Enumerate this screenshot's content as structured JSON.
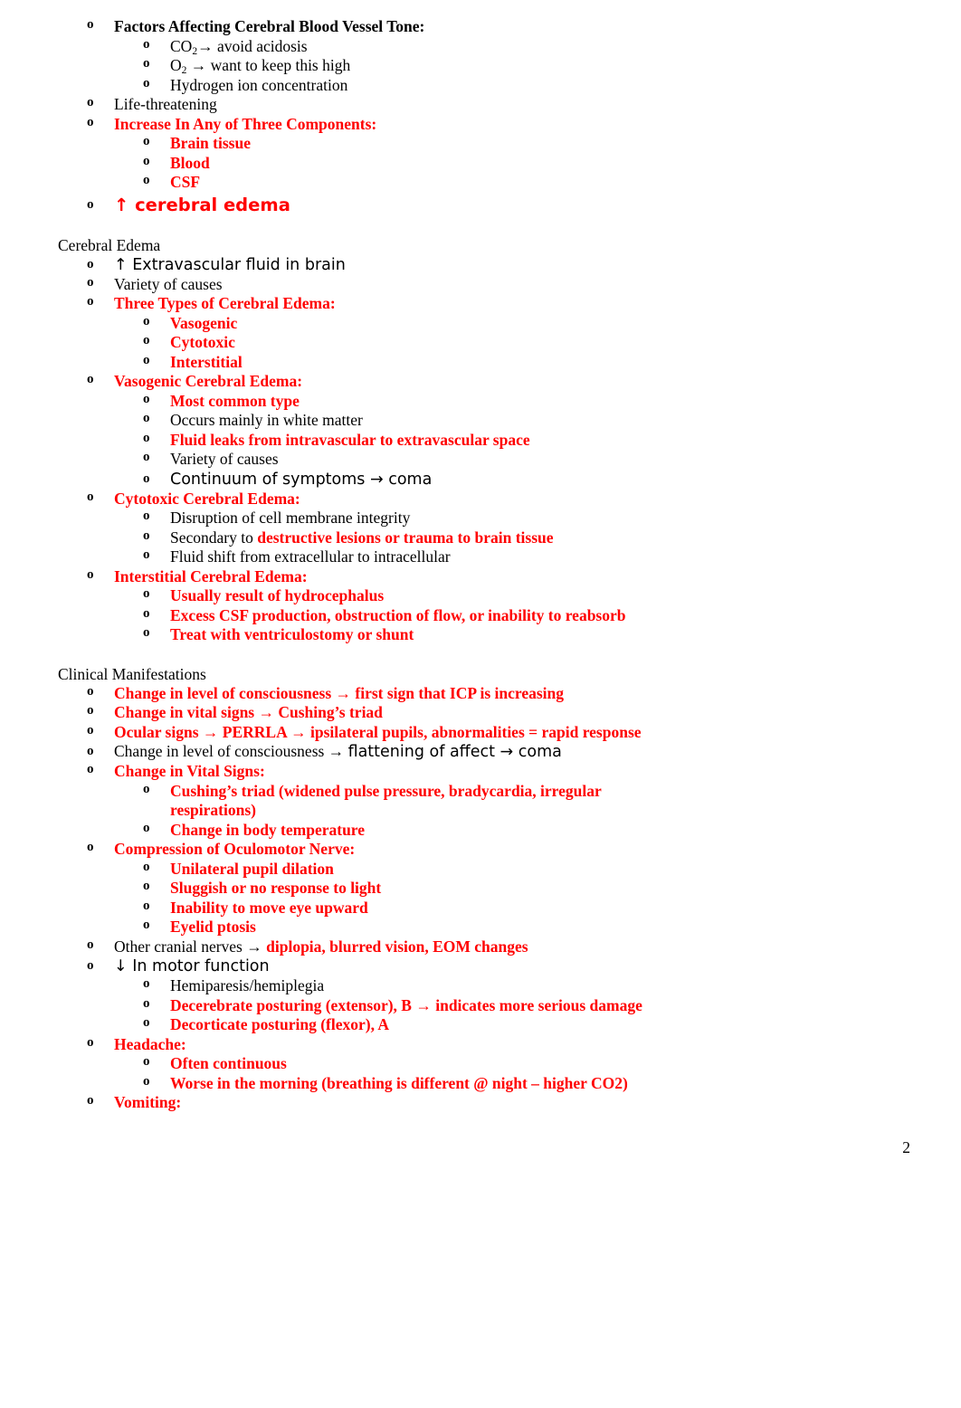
{
  "document": {
    "page_number": "2",
    "accent_color": "#FF0000",
    "text_color": "#000000"
  },
  "sections": [
    {
      "id": "icp-factors",
      "heading": null,
      "lines": [
        {
          "level": 1,
          "bullet": "o",
          "style": "serif-b",
          "color": "red_no",
          "text": "Factors Affecting Cerebral Blood Vessel Tone:"
        },
        {
          "level": 2,
          "bullet": "o",
          "style": "serif",
          "text": "CO2→ avoid acidosis"
        },
        {
          "level": 2,
          "bullet": "o",
          "style": "serif",
          "text": "O2 → want to keep this high"
        },
        {
          "level": 2,
          "bullet": "o",
          "style": "serif",
          "text": "Hydrogen ion concentration"
        },
        {
          "level": 1,
          "bullet": "o",
          "style": "serif",
          "text": "Life-threatening"
        },
        {
          "level": 1,
          "bullet": "o",
          "style": "serif-b",
          "text": "Increase In Any of Three Components:"
        },
        {
          "level": 2,
          "bullet": "o",
          "style": "serif-b",
          "text": "Brain tissue"
        },
        {
          "level": 2,
          "bullet": "o",
          "style": "serif-b",
          "text": "Blood"
        },
        {
          "level": 2,
          "bullet": "o",
          "style": "serif-b",
          "text": "CSF"
        },
        {
          "level": 1,
          "bullet": "o",
          "style": "sans-b",
          "text": "↑ cerebral edema"
        }
      ]
    },
    {
      "id": "cerebral-edema",
      "heading": "Cerebral Edema",
      "lines": [
        {
          "level": 1,
          "bullet": "o",
          "style": "sans",
          "text": "↑ Extravascular fluid in brain"
        },
        {
          "level": 1,
          "bullet": "o",
          "style": "serif",
          "text": "Variety of causes"
        },
        {
          "level": 1,
          "bullet": "o",
          "style": "serif-b",
          "text": "Three Types of Cerebral Edema:"
        },
        {
          "level": 2,
          "bullet": "o",
          "style": "serif-b",
          "text": "Vasogenic"
        },
        {
          "level": 2,
          "bullet": "o",
          "style": "serif-b",
          "text": "Cytotoxic"
        },
        {
          "level": 2,
          "bullet": "o",
          "style": "serif-b",
          "text": "Interstitial"
        },
        {
          "level": 1,
          "bullet": "o",
          "style": "serif-b",
          "text": "Vasogenic Cerebral Edema:"
        },
        {
          "level": 2,
          "bullet": "o",
          "style": "serif-b",
          "text": "Most common type"
        },
        {
          "level": 2,
          "bullet": "o",
          "style": "serif",
          "text": "Occurs mainly in white matter"
        },
        {
          "level": 2,
          "bullet": "o",
          "style": "serif-b",
          "text": "Fluid leaks from intravascular to extravascular space"
        },
        {
          "level": 2,
          "bullet": "o",
          "style": "serif",
          "text": "Variety of causes"
        },
        {
          "level": 2,
          "bullet": "o",
          "style": "sans",
          "text": "Continuum of symptoms → coma"
        },
        {
          "level": 1,
          "bullet": "o",
          "style": "serif-b",
          "text": "Cytotoxic Cerebral Edema:"
        },
        {
          "level": 2,
          "bullet": "o",
          "style": "serif",
          "text": "Disruption of  cell membrane integrity"
        },
        {
          "level": 2,
          "bullet": "o",
          "style": "serif",
          "text": "Secondary to destructive lesions or trauma to brain tissue"
        },
        {
          "level": 2,
          "bullet": "o",
          "style": "serif",
          "text": "Fluid shift from extracellular to intracellular"
        },
        {
          "level": 1,
          "bullet": "o",
          "style": "serif-b",
          "text": "Interstitial Cerebral Edema:"
        },
        {
          "level": 2,
          "bullet": "o",
          "style": "serif-b",
          "text": "Usually result of  hydrocephalus"
        },
        {
          "level": 2,
          "bullet": "o",
          "style": "serif-b",
          "text": "Excess CSF production, obstruction of flow, or inability to reabsorb"
        },
        {
          "level": 2,
          "bullet": "o",
          "style": "serif-b",
          "text": "Treat with ventriculostomy or shunt"
        }
      ]
    },
    {
      "id": "clinical-manifestations",
      "heading": "Clinical Manifestations",
      "lines": [
        {
          "level": 1,
          "bullet": "o",
          "style": "serif-b",
          "text": "Change in level of consciousness → first sign that ICP is increasing"
        },
        {
          "level": 1,
          "bullet": "o",
          "style": "serif-b",
          "text": "Change in vital signs → Cushing’s triad"
        },
        {
          "level": 1,
          "bullet": "o",
          "style": "serif-b",
          "text": "Ocular signs → PERRLA → ipsilateral pupils, abnormalities = rapid response"
        },
        {
          "level": 1,
          "bullet": "o",
          "style": "mixed",
          "text": "Change in level of consciousness → flattening of affect → coma"
        },
        {
          "level": 1,
          "bullet": "o",
          "style": "serif-b",
          "text": "Change in Vital Signs:"
        },
        {
          "level": 2,
          "bullet": "o",
          "style": "serif-b",
          "text": "Cushing’s triad (widened pulse pressure, bradycardia, irregular respirations)"
        },
        {
          "level": 2,
          "bullet": "o",
          "style": "serif-b",
          "text": "Change in body temperature"
        },
        {
          "level": 1,
          "bullet": "o",
          "style": "serif-b",
          "text": "Compression of Oculomotor Nerve:"
        },
        {
          "level": 2,
          "bullet": "o",
          "style": "serif-b",
          "text": "Unilateral pupil dilation"
        },
        {
          "level": 2,
          "bullet": "o",
          "style": "serif-b",
          "text": "Sluggish or no response to light"
        },
        {
          "level": 2,
          "bullet": "o",
          "style": "serif-b",
          "text": "Inability to move eye upward"
        },
        {
          "level": 2,
          "bullet": "o",
          "style": "serif-b",
          "text": "Eyelid ptosis"
        },
        {
          "level": 1,
          "bullet": "o",
          "style": "serif",
          "text": "Other cranial nerves → diplopia, blurred vision,  EOM changes"
        },
        {
          "level": 1,
          "bullet": "o",
          "style": "sans",
          "text": "↓ In motor function"
        },
        {
          "level": 2,
          "bullet": "o",
          "style": "serif",
          "text": "Hemiparesis/hemiplegia"
        },
        {
          "level": 2,
          "bullet": "o",
          "style": "serif-b",
          "text": "Decerebrate posturing (extensor), B → indicates more serious damage"
        },
        {
          "level": 2,
          "bullet": "o",
          "style": "serif-b",
          "text": "Decorticate posturing (flexor), A"
        },
        {
          "level": 1,
          "bullet": "o",
          "style": "serif-b",
          "text": "Headache:"
        },
        {
          "level": 2,
          "bullet": "o",
          "style": "serif-b",
          "text": "Often continuous"
        },
        {
          "level": 2,
          "bullet": "o",
          "style": "serif-b",
          "text": "Worse in the morning (breathing is different @ night – higher CO2)"
        },
        {
          "level": 1,
          "bullet": "o",
          "style": "serif-b",
          "text": "Vomiting:"
        }
      ]
    }
  ],
  "text": {
    "s1_l1": "Factors Affecting Cerebral Blood Vessel Tone:",
    "s1_l2a": "CO",
    "s1_l2b": "2",
    "s1_l2c": "→ avoid acidosis",
    "s1_l3a": "O",
    "s1_l3b": "2",
    "s1_l3c": " → want to keep this high",
    "s1_l4": "Hydrogen ion concentration",
    "s1_l5": "Life-threatening",
    "s1_l6": "Increase In Any of Three Components:",
    "s1_l7": "Brain tissue",
    "s1_l8": "Blood",
    "s1_l9": "CSF",
    "s1_l10": "↑ cerebral edema",
    "s2_heading": "Cerebral Edema",
    "s2_l1": "↑ Extravascular fluid in brain",
    "s2_l2": "Variety of causes",
    "s2_l3": "Three Types of Cerebral Edema:",
    "s2_l4": "Vasogenic",
    "s2_l5": "Cytotoxic",
    "s2_l6": "Interstitial",
    "s2_l7": "Vasogenic Cerebral Edema:",
    "s2_l8": "Most common type",
    "s2_l9": "Occurs mainly in white matter",
    "s2_l10": "Fluid leaks from intravascular to extravascular space",
    "s2_l11": "Variety of causes",
    "s2_l12": "Continuum of symptoms → coma",
    "s2_l13": "Cytotoxic Cerebral Edema:",
    "s2_l14": "Disruption of  cell membrane integrity",
    "s2_l15a": "Secondary to ",
    "s2_l15b": "destructive lesions or trauma to brain tissue",
    "s2_l16": "Fluid shift from extracellular to intracellular",
    "s2_l17": "Interstitial Cerebral Edema:",
    "s2_l18": "Usually result of  hydrocephalus",
    "s2_l19": "Excess CSF production, obstruction of flow, or inability to reabsorb",
    "s2_l20": "Treat with ventriculostomy or shunt",
    "s3_heading": "Clinical Manifestations",
    "s3_l1": "Change in level of consciousness → first sign that ICP is increasing",
    "s3_l2": "Change in vital signs → Cushing’s triad",
    "s3_l3": "Ocular signs → PERRLA → ipsilateral pupils, abnormalities = rapid response",
    "s3_l4a": "Change in level of consciousness → ",
    "s3_l4b": "flattening of affect → coma",
    "s3_l5": "Change in Vital Signs:",
    "s3_l6": "Cushing’s triad (widened pulse pressure, bradycardia, irregular respirations)",
    "s3_l7": "Change in body temperature",
    "s3_l8": "Compression of Oculomotor Nerve:",
    "s3_l9": "Unilateral pupil dilation",
    "s3_l10": "Sluggish or no response to light",
    "s3_l11": "Inability to move eye upward",
    "s3_l12": "Eyelid ptosis",
    "s3_l13a": "Other cranial nerves → ",
    "s3_l13b": "diplopia, blurred vision,  EOM changes",
    "s3_l14": "↓ In motor function",
    "s3_l15": "Hemiparesis/hemiplegia",
    "s3_l16": "Decerebrate posturing (extensor), B → indicates more serious damage",
    "s3_l17": "Decorticate posturing (flexor), A",
    "s3_l18": "Headache:",
    "s3_l19": "Often continuous",
    "s3_l20": "Worse in the morning (breathing is different @ night – higher CO2)",
    "s3_l21": "Vomiting:"
  },
  "bullets": {
    "glyph": "o"
  }
}
